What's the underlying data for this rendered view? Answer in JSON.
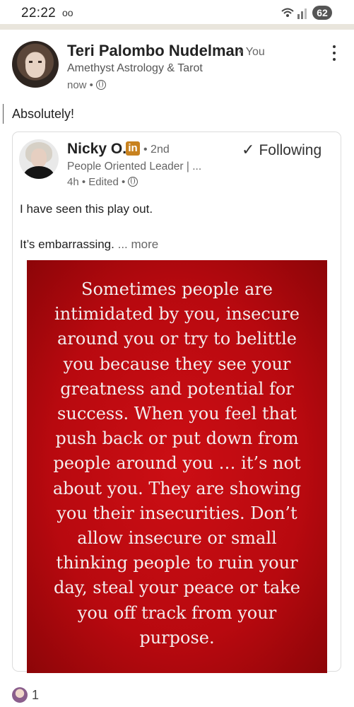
{
  "status_bar": {
    "time": "22:22",
    "voicemail": "oo",
    "battery": "62"
  },
  "post": {
    "author_name": "Teri Palombo Nudelman",
    "author_relation": "• You",
    "author_headline": "Amethyst Astrology & Tarot",
    "timestamp": "now •",
    "comment": "Absolutely!"
  },
  "shared": {
    "author_name": "Nicky O.",
    "linkedin_badge": "in",
    "degree": "• 2nd",
    "follow_label": "Following",
    "follow_check": "✓",
    "headline": "People Oriented Leader | ...",
    "meta": "4h • Edited •",
    "text_line1": "I have seen this play out.",
    "text_line2": "It’s embarrassing.",
    "more_label": "... more",
    "image_text": "Sometimes people are\nintimidated by you, insecure\naround you or try to belittle\nyou because they see your\ngreatness and potential for\nsuccess.  When you feel that\npush back or put down from\npeople around you … it’s not\nabout you. They are showing\nyou their insecurities. Don’t\nallow insecure or small\nthinking people to ruin your\nday, steal your peace or take\nyou off track from your\npurpose."
  },
  "reactions": {
    "count": "1"
  },
  "colors": {
    "quote_bg": "#c00c12",
    "linkedin_badge": "#c8821f",
    "band": "#e9e5dc"
  },
  "icons": [
    "voicemail-icon",
    "wifi-signal-icon",
    "globe-icon",
    "more-menu-icon",
    "check-icon",
    "reaction-icon"
  ]
}
